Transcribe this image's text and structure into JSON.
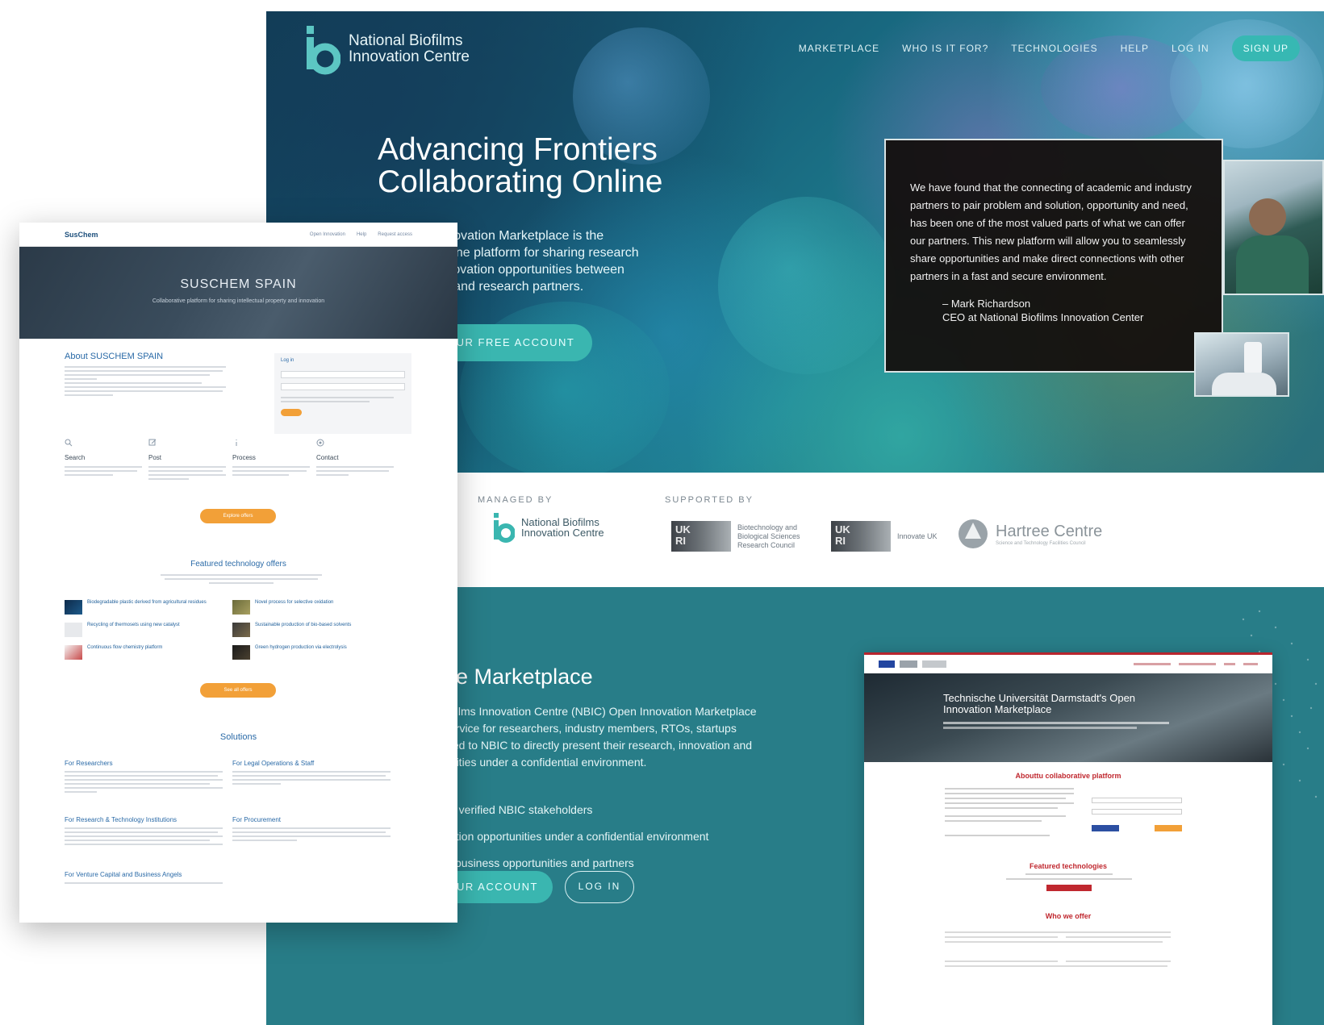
{
  "nbic": {
    "logo": {
      "line1": "National Biofilms",
      "line2": "Innovation Centre",
      "icon": "nbic-logo-mark"
    },
    "nav": [
      "MARKETPLACE",
      "WHO IS IT FOR?",
      "TECHNOLOGIES",
      "HELP",
      "LOG IN"
    ],
    "signup_label": "SIGN UP",
    "hero": {
      "title_line1": "Advancing Frontiers",
      "title_line2": "Collaborating Online",
      "desc_l1": "Innovation Marketplace is the",
      "desc_l2": "online platform for sharing research",
      "desc_l3": "innovation opportunities between",
      "desc_l4": "try and research partners.",
      "cta": "OUR FREE ACCOUNT"
    },
    "quote": {
      "text": "We have found that the connecting of academic and industry partners to pair problem and solution, opportunity and need, has been one of the most valued parts of what we can offer our partners. This new platform will allow you to seamlessly share opportunities and make direct connections with other partners in a fast and secure environment.",
      "author_name": "– Mark Richardson",
      "author_title": "CEO at National Biofilms Innovation Center"
    },
    "partners": {
      "managed_label": "MANAGED BY",
      "supported_label": "SUPPORTED BY",
      "nbic_l1": "National Biofilms",
      "nbic_l2": "Innovation Centre",
      "ukri_mark_l1": "UK",
      "ukri_mark_l2": "RI",
      "bbsrc_text": "Biotechnology and Biological Sciences Research Council",
      "innovate_text": "Innovate UK",
      "hartree_text": "Hartree Centre",
      "hartree_sub": "Science and Technology Facilities Council"
    },
    "marketplace": {
      "title": "he Marketplace",
      "desc_l1": "iofilms Innovation Centre (NBIC) Open Innovation Marketplace",
      "desc_l2": "service for researchers, industry members, RTOs, startups",
      "desc_l3": "itted to NBIC to directly present their research, innovation and",
      "desc_l4": "unities under a confidential environment.",
      "bullet_1": "ith verified NBIC stakeholders",
      "bullet_2": "vation opportunities under a confidential environment",
      "bullet_3": "w business opportunities and partners",
      "create_label": "UR ACCOUNT",
      "login_label": "LOG IN"
    }
  },
  "tu": {
    "hero_title": "Technische Universität Darmstadt's Open Innovation Marketplace",
    "heading_1": "Abouttu collaborative platform",
    "heading_2": "Featured technologies",
    "heading_3": "Who we offer"
  },
  "suschem": {
    "logo": "SusChem",
    "nav": [
      "Open Innovation",
      "Help",
      "Request access"
    ],
    "hero_title": "SUSCHEM SPAIN",
    "hero_sub": "Collaborative platform for sharing intellectual property and innovation",
    "about_title": "About SUSCHEM SPAIN",
    "login_title": "Log in",
    "features": [
      {
        "icon": "search-icon",
        "title": "Search"
      },
      {
        "icon": "edit-icon",
        "title": "Post"
      },
      {
        "icon": "info-icon",
        "title": "Process"
      },
      {
        "icon": "contact-icon",
        "title": "Contact"
      }
    ],
    "btn_explore": "Explore offers",
    "featured_title": "Featured technology offers",
    "offers": [
      "Biodegradable plastic derived from agricultural residues",
      "Novel process for selective oxidation",
      "Recycling of thermosets using new catalyst",
      "Sustainable production of bio-based solvents",
      "Continuous flow chemistry platform",
      "Green hydrogen production via electrolysis"
    ],
    "btn_see_all": "See all offers",
    "solutions_title": "Solutions",
    "solutions": [
      "For Researchers",
      "For Legal Operations & Staff",
      "For Research & Technology Institutions",
      "For Procurement",
      "For Venture Capital and Business Angels"
    ]
  },
  "colors": {
    "nbic_teal": "#287d88",
    "nbic_button": "#3ab6b0",
    "tu_red": "#c0282f",
    "suschem_blue": "#2a6aa7",
    "suschem_orange": "#f2a038"
  }
}
